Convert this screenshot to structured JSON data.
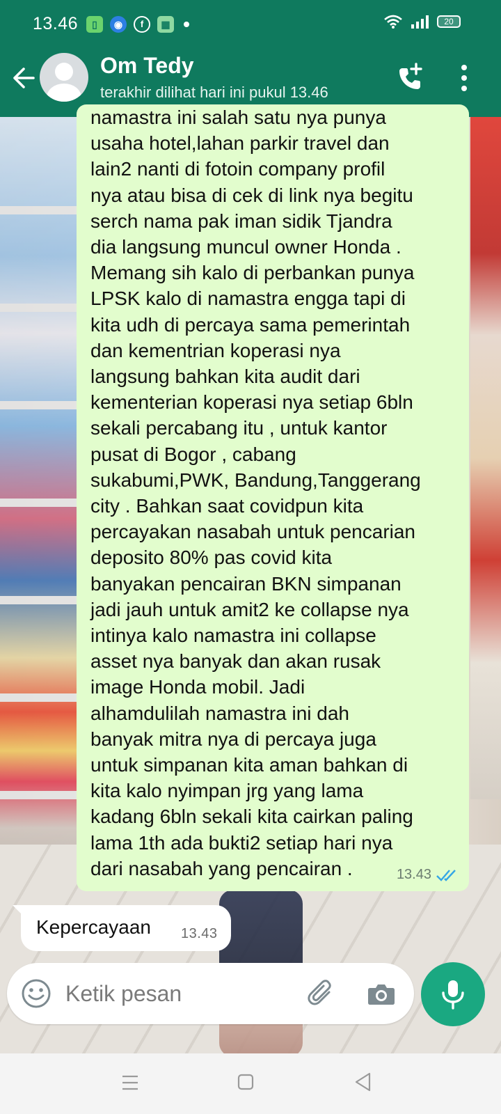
{
  "status_bar": {
    "time": "13.46",
    "battery": "20",
    "icons": [
      "app-icon",
      "messenger-icon",
      "facebook-icon",
      "gallery-icon",
      "notification-dot",
      "wifi-icon",
      "signal-icon",
      "battery-icon"
    ]
  },
  "header": {
    "contact_name": "Om Tedy",
    "last_seen": "terakhir dilihat hari ini pukul 13.46",
    "icons": [
      "back-arrow-icon",
      "avatar",
      "add-call-icon",
      "more-vert-icon"
    ]
  },
  "messages": [
    {
      "direction": "outgoing",
      "text": "namastra ini salah satu nya punya\nusaha hotel,lahan parkir travel dan\nlain2 nanti di fotoin company profil\nnya atau bisa di cek di link nya begitu\nserch nama pak iman sidik Tjandra\ndia langsung muncul owner Honda .\nMemang sih kalo di perbankan punya\nLPSK kalo di namastra engga tapi di\nkita udh di percaya sama pemerintah\ndan kementrian koperasi nya\nlangsung bahkan kita audit dari\nkementerian koperasi nya setiap 6bln\nsekali percabang itu , untuk kantor\npusat di Bogor , cabang\nsukabumi,PWK, Bandung,Tanggerang\ncity . Bahkan saat covidpun kita\npercayakan nasabah untuk pencarian\ndeposito 80% pas covid kita\nbanyakan pencairan BKN simpanan\njadi jauh untuk amit2 ke collapse nya\nintinya kalo namastra ini collapse\nasset nya banyak dan akan rusak\nimage Honda mobil. Jadi\nalhamdulilah namastra ini dah\nbanyak mitra nya di percaya juga\nuntuk simpanan kita aman bahkan di\nkita kalo nyimpan jrg yang lama\nkadang 6bln sekali kita cairkan paling\nlama 1th ada bukti2 setiap hari nya\ndari nasabah yang pencairan .",
      "time": "13.43",
      "status": "read"
    },
    {
      "direction": "incoming",
      "text": "Kepercayaan",
      "time": "13.43"
    }
  ],
  "input": {
    "placeholder": "Ketik pesan"
  },
  "colors": {
    "header": "#0f7a5e",
    "outgoing_bubble": "#e2fdcd",
    "incoming_bubble": "#ffffff",
    "mic_button": "#1aa881",
    "read_ticks": "#34a6e6"
  }
}
